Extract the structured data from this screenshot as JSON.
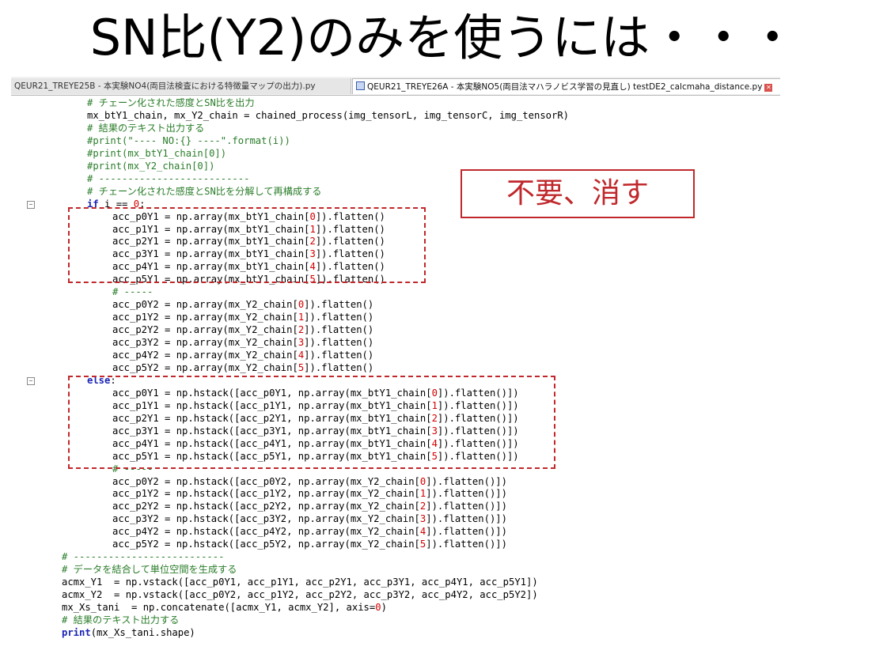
{
  "title": "SN比(Y2)のみを使うには・・・",
  "tabs": [
    {
      "label": "QEUR21_TREYE25B - 本実験NO4(両目法検査における特徴量マップの出力).py"
    },
    {
      "label": "QEUR21_TREYE26A - 本実験NO5(両目法マハラノビス学習の見直し) testDE2_calcmaha_distance.py"
    }
  ],
  "note": "不要、消す",
  "icons": {
    "save": "save-icon",
    "close": "close-icon",
    "fold": "fold-minus-icon"
  },
  "colors": {
    "annotation": "#c0282c",
    "comment": "#2a7d2a",
    "keyword": "#1a25b5",
    "number": "#d40000"
  },
  "code_lines": [
    {
      "indent": 8,
      "parts": [
        {
          "t": "# チェーン化された感度とSN比を出力",
          "s": "cmt"
        }
      ]
    },
    {
      "indent": 8,
      "parts": [
        {
          "t": "mx_btY1_chain, mx_Y2_chain = chained_process(img_tensorL, img_tensorC, img_tensorR)",
          "s": ""
        }
      ]
    },
    {
      "indent": 8,
      "parts": [
        {
          "t": "# 結果のテキスト出力する",
          "s": "cmt"
        }
      ]
    },
    {
      "indent": 8,
      "parts": [
        {
          "t": "#print(\"---- NO:{} ----\".format(i))",
          "s": "cmt"
        }
      ]
    },
    {
      "indent": 8,
      "parts": [
        {
          "t": "#print(mx_btY1_chain[0])",
          "s": "cmt"
        }
      ]
    },
    {
      "indent": 8,
      "parts": [
        {
          "t": "#print(mx_Y2_chain[0])",
          "s": "cmt"
        }
      ]
    },
    {
      "indent": 8,
      "parts": [
        {
          "t": "# --------------------------",
          "s": "cmt"
        }
      ]
    },
    {
      "indent": 8,
      "parts": [
        {
          "t": "# チェーン化された感度とSN比を分解して再構成する",
          "s": "cmt"
        }
      ]
    },
    {
      "indent": 8,
      "parts": [
        {
          "t": "if",
          "s": "kw"
        },
        {
          "t": " i == ",
          "s": ""
        },
        {
          "t": "0",
          "s": "num"
        },
        {
          "t": ":",
          "s": ""
        }
      ]
    },
    {
      "indent": 12,
      "parts": [
        {
          "t": "acc_p0Y1 = np.array(mx_btY1_chain[",
          "s": ""
        },
        {
          "t": "0",
          "s": "num"
        },
        {
          "t": "]).flatten()",
          "s": ""
        }
      ]
    },
    {
      "indent": 12,
      "parts": [
        {
          "t": "acc_p1Y1 = np.array(mx_btY1_chain[",
          "s": ""
        },
        {
          "t": "1",
          "s": "num"
        },
        {
          "t": "]).flatten()",
          "s": ""
        }
      ]
    },
    {
      "indent": 12,
      "parts": [
        {
          "t": "acc_p2Y1 = np.array(mx_btY1_chain[",
          "s": ""
        },
        {
          "t": "2",
          "s": "num"
        },
        {
          "t": "]).flatten()",
          "s": ""
        }
      ]
    },
    {
      "indent": 12,
      "parts": [
        {
          "t": "acc_p3Y1 = np.array(mx_btY1_chain[",
          "s": ""
        },
        {
          "t": "3",
          "s": "num"
        },
        {
          "t": "]).flatten()",
          "s": ""
        }
      ]
    },
    {
      "indent": 12,
      "parts": [
        {
          "t": "acc_p4Y1 = np.array(mx_btY1_chain[",
          "s": ""
        },
        {
          "t": "4",
          "s": "num"
        },
        {
          "t": "]).flatten()",
          "s": ""
        }
      ]
    },
    {
      "indent": 12,
      "parts": [
        {
          "t": "acc_p5Y1 = np.array(mx_btY1_chain[",
          "s": ""
        },
        {
          "t": "5",
          "s": "num"
        },
        {
          "t": "]).flatten()",
          "s": ""
        }
      ]
    },
    {
      "indent": 12,
      "parts": [
        {
          "t": "# -----",
          "s": "cmt"
        }
      ]
    },
    {
      "indent": 12,
      "parts": [
        {
          "t": "acc_p0Y2 = np.array(mx_Y2_chain[",
          "s": ""
        },
        {
          "t": "0",
          "s": "num"
        },
        {
          "t": "]).flatten()",
          "s": ""
        }
      ]
    },
    {
      "indent": 12,
      "parts": [
        {
          "t": "acc_p1Y2 = np.array(mx_Y2_chain[",
          "s": ""
        },
        {
          "t": "1",
          "s": "num"
        },
        {
          "t": "]).flatten()",
          "s": ""
        }
      ]
    },
    {
      "indent": 12,
      "parts": [
        {
          "t": "acc_p2Y2 = np.array(mx_Y2_chain[",
          "s": ""
        },
        {
          "t": "2",
          "s": "num"
        },
        {
          "t": "]).flatten()",
          "s": ""
        }
      ]
    },
    {
      "indent": 12,
      "parts": [
        {
          "t": "acc_p3Y2 = np.array(mx_Y2_chain[",
          "s": ""
        },
        {
          "t": "3",
          "s": "num"
        },
        {
          "t": "]).flatten()",
          "s": ""
        }
      ]
    },
    {
      "indent": 12,
      "parts": [
        {
          "t": "acc_p4Y2 = np.array(mx_Y2_chain[",
          "s": ""
        },
        {
          "t": "4",
          "s": "num"
        },
        {
          "t": "]).flatten()",
          "s": ""
        }
      ]
    },
    {
      "indent": 12,
      "parts": [
        {
          "t": "acc_p5Y2 = np.array(mx_Y2_chain[",
          "s": ""
        },
        {
          "t": "5",
          "s": "num"
        },
        {
          "t": "]).flatten()",
          "s": ""
        }
      ]
    },
    {
      "indent": 8,
      "parts": [
        {
          "t": "else",
          "s": "kw"
        },
        {
          "t": ":",
          "s": ""
        }
      ]
    },
    {
      "indent": 12,
      "parts": [
        {
          "t": "acc_p0Y1 = np.hstack([acc_p0Y1, np.array(mx_btY1_chain[",
          "s": ""
        },
        {
          "t": "0",
          "s": "num"
        },
        {
          "t": "]).flatten()])",
          "s": ""
        }
      ]
    },
    {
      "indent": 12,
      "parts": [
        {
          "t": "acc_p1Y1 = np.hstack([acc_p1Y1, np.array(mx_btY1_chain[",
          "s": ""
        },
        {
          "t": "1",
          "s": "num"
        },
        {
          "t": "]).flatten()])",
          "s": ""
        }
      ]
    },
    {
      "indent": 12,
      "parts": [
        {
          "t": "acc_p2Y1 = np.hstack([acc_p2Y1, np.array(mx_btY1_chain[",
          "s": ""
        },
        {
          "t": "2",
          "s": "num"
        },
        {
          "t": "]).flatten()])",
          "s": ""
        }
      ]
    },
    {
      "indent": 12,
      "parts": [
        {
          "t": "acc_p3Y1 = np.hstack([acc_p3Y1, np.array(mx_btY1_chain[",
          "s": ""
        },
        {
          "t": "3",
          "s": "num"
        },
        {
          "t": "]).flatten()])",
          "s": ""
        }
      ]
    },
    {
      "indent": 12,
      "parts": [
        {
          "t": "acc_p4Y1 = np.hstack([acc_p4Y1, np.array(mx_btY1_chain[",
          "s": ""
        },
        {
          "t": "4",
          "s": "num"
        },
        {
          "t": "]).flatten()])",
          "s": ""
        }
      ]
    },
    {
      "indent": 12,
      "parts": [
        {
          "t": "acc_p5Y1 = np.hstack([acc_p5Y1, np.array(mx_btY1_chain[",
          "s": ""
        },
        {
          "t": "5",
          "s": "num"
        },
        {
          "t": "]).flatten()])",
          "s": ""
        }
      ]
    },
    {
      "indent": 12,
      "parts": [
        {
          "t": "# -----",
          "s": "cmt"
        }
      ]
    },
    {
      "indent": 12,
      "parts": [
        {
          "t": "acc_p0Y2 = np.hstack([acc_p0Y2, np.array(mx_Y2_chain[",
          "s": ""
        },
        {
          "t": "0",
          "s": "num"
        },
        {
          "t": "]).flatten()])",
          "s": ""
        }
      ]
    },
    {
      "indent": 12,
      "parts": [
        {
          "t": "acc_p1Y2 = np.hstack([acc_p1Y2, np.array(mx_Y2_chain[",
          "s": ""
        },
        {
          "t": "1",
          "s": "num"
        },
        {
          "t": "]).flatten()])",
          "s": ""
        }
      ]
    },
    {
      "indent": 12,
      "parts": [
        {
          "t": "acc_p2Y2 = np.hstack([acc_p2Y2, np.array(mx_Y2_chain[",
          "s": ""
        },
        {
          "t": "2",
          "s": "num"
        },
        {
          "t": "]).flatten()])",
          "s": ""
        }
      ]
    },
    {
      "indent": 12,
      "parts": [
        {
          "t": "acc_p3Y2 = np.hstack([acc_p3Y2, np.array(mx_Y2_chain[",
          "s": ""
        },
        {
          "t": "3",
          "s": "num"
        },
        {
          "t": "]).flatten()])",
          "s": ""
        }
      ]
    },
    {
      "indent": 12,
      "parts": [
        {
          "t": "acc_p4Y2 = np.hstack([acc_p4Y2, np.array(mx_Y2_chain[",
          "s": ""
        },
        {
          "t": "4",
          "s": "num"
        },
        {
          "t": "]).flatten()])",
          "s": ""
        }
      ]
    },
    {
      "indent": 12,
      "parts": [
        {
          "t": "acc_p5Y2 = np.hstack([acc_p5Y2, np.array(mx_Y2_chain[",
          "s": ""
        },
        {
          "t": "5",
          "s": "num"
        },
        {
          "t": "]).flatten()])",
          "s": ""
        }
      ]
    },
    {
      "indent": 4,
      "parts": [
        {
          "t": "# --------------------------",
          "s": "cmt"
        }
      ]
    },
    {
      "indent": 4,
      "parts": [
        {
          "t": "# データを結合して単位空間を生成する",
          "s": "cmt"
        }
      ]
    },
    {
      "indent": 4,
      "parts": [
        {
          "t": "acmx_Y1  = np.vstack([acc_p0Y1, acc_p1Y1, acc_p2Y1, acc_p3Y1, acc_p4Y1, acc_p5Y1])",
          "s": ""
        }
      ]
    },
    {
      "indent": 4,
      "parts": [
        {
          "t": "acmx_Y2  = np.vstack([acc_p0Y2, acc_p1Y2, acc_p2Y2, acc_p3Y2, acc_p4Y2, acc_p5Y2])",
          "s": ""
        }
      ]
    },
    {
      "indent": 4,
      "parts": [
        {
          "t": "mx_Xs_tani  = np.concatenate([acmx_Y1, acmx_Y2], axis=",
          "s": ""
        },
        {
          "t": "0",
          "s": "num"
        },
        {
          "t": ")",
          "s": ""
        }
      ]
    },
    {
      "indent": 4,
      "parts": [
        {
          "t": "# 結果のテキスト出力する",
          "s": "cmt"
        }
      ]
    },
    {
      "indent": 4,
      "parts": [
        {
          "t": "print",
          "s": "kw"
        },
        {
          "t": "(mx_Xs_tani.shape)",
          "s": ""
        }
      ]
    }
  ]
}
